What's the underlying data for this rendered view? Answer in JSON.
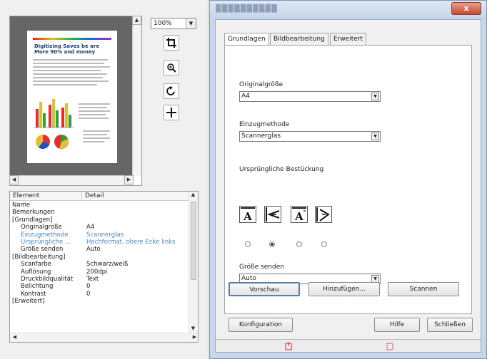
{
  "zoom": {
    "value": "100%"
  },
  "preview": {
    "heading_line1": "Digitizing Saves be are",
    "heading_line2": "More 90% and money"
  },
  "detail_list": {
    "col_element": "Element",
    "col_detail": "Detail",
    "rows": [
      {
        "key": "Name",
        "value": "",
        "indent": 0,
        "selected": false
      },
      {
        "key": "Bemerkungen",
        "value": "",
        "indent": 0,
        "selected": false
      },
      {
        "key": "[Grundlagen]",
        "value": "",
        "indent": 0,
        "selected": false
      },
      {
        "key": "Originalgröße",
        "value": "A4",
        "indent": 1,
        "selected": false
      },
      {
        "key": "Einzugmethode",
        "value": "Scannerglas",
        "indent": 1,
        "selected": true
      },
      {
        "key": "Ursprüngliche ...",
        "value": "Hochformat, obere Ecke links",
        "indent": 1,
        "selected": true
      },
      {
        "key": "Größe senden",
        "value": "Auto",
        "indent": 1,
        "selected": false
      },
      {
        "key": "[Bildbearbeitung]",
        "value": "",
        "indent": 0,
        "selected": false
      },
      {
        "key": "Scanfarbe",
        "value": "Schwarz/weiß",
        "indent": 1,
        "selected": false
      },
      {
        "key": "Auflösung",
        "value": "200dpi",
        "indent": 1,
        "selected": false
      },
      {
        "key": "Druckbildqualität",
        "value": "Text",
        "indent": 1,
        "selected": false
      },
      {
        "key": "Belichtung",
        "value": "0",
        "indent": 1,
        "selected": false
      },
      {
        "key": "Kontrast",
        "value": "0",
        "indent": 1,
        "selected": false
      },
      {
        "key": "[Erweitert]",
        "value": "",
        "indent": 0,
        "selected": false
      }
    ]
  },
  "dialog": {
    "close": "x",
    "tabs": [
      "Grundlagen",
      "Bildbearbeitung",
      "Erweitert"
    ],
    "original_size": {
      "label": "Originalgröße",
      "value": "A4"
    },
    "feed_method": {
      "label": "Einzugmethode",
      "value": "Scannerglas"
    },
    "orientation": {
      "label": "Ursprüngliche Bestückung"
    },
    "send_size": {
      "label": "Größe senden",
      "value": "Auto"
    },
    "buttons": {
      "preview": "Vorschau",
      "add": "Hinzufügen...",
      "scan": "Scannen",
      "config": "Konfiguration",
      "help": "Hilfe",
      "close": "Schließen"
    }
  }
}
